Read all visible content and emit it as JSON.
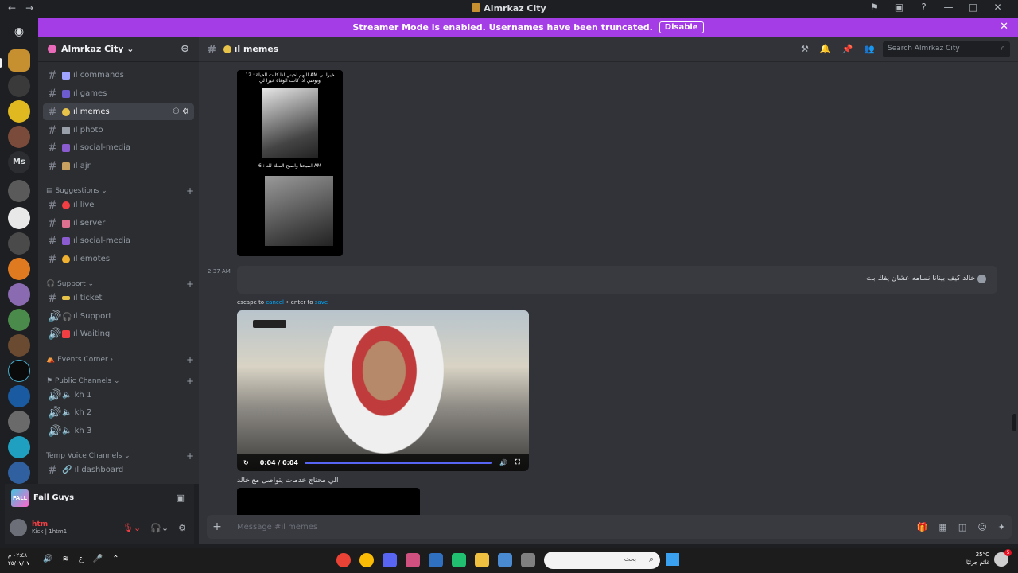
{
  "window": {
    "title": "Almrkaz City",
    "nav_back": "←",
    "nav_fwd": "→",
    "controls": [
      "⚑",
      "▣",
      "?",
      "—",
      "□",
      "✕"
    ]
  },
  "banner": {
    "text": "Streamer Mode is enabled. Usernames have been truncated.",
    "button": "Disable",
    "close": "✕"
  },
  "guilds": {
    "ms_label": "Ms"
  },
  "server": {
    "name": "Almrkaz City ⌄",
    "add_icon": "person-add-icon"
  },
  "channels": [
    {
      "name": "ıl commands",
      "emoji_color": "#a0a4ff"
    },
    {
      "name": "ıl games",
      "emoji_color": "#6d5bd0"
    },
    {
      "name": "ıl memes",
      "emoji_color": "#e8c34a",
      "active": true
    },
    {
      "name": "ıl photo",
      "emoji_color": "#9aa0aa"
    },
    {
      "name": "ıl social-media",
      "emoji_color": "#8a5cd0"
    },
    {
      "name": "ıl ajr",
      "emoji_color": "#c8a060"
    }
  ],
  "categories": {
    "suggestions": "Suggestions",
    "support": "Support",
    "events": "Events Corner",
    "public": "Public Channels",
    "temp": "Temp Voice Channels"
  },
  "suggestion_channels": [
    {
      "name": "ıl live",
      "emoji_color": "#f23f43"
    },
    {
      "name": "ıl server",
      "emoji_color": "#e07090"
    },
    {
      "name": "ıl social-media",
      "emoji_color": "#8a5cd0"
    },
    {
      "name": "ıl emotes",
      "emoji_color": "#f0b030"
    }
  ],
  "support_channels": [
    {
      "name": "ıl ticket",
      "emoji_color": "#e8c34a"
    },
    {
      "name": "ıl Support",
      "emoji_color": "#b5bac1"
    },
    {
      "name": "ıl Waiting",
      "emoji_color": "#f23f43"
    }
  ],
  "voice_channels": [
    "kh 1",
    "kh 2",
    "kh 3"
  ],
  "temp_channels": [
    "ıl dashboard"
  ],
  "game": {
    "logo": "FALL GUYS",
    "name": "Fall Guys"
  },
  "user": {
    "name": "htm",
    "status": "Kick | 1htm1"
  },
  "chat": {
    "channel_name": "ıl memes",
    "search_placeholder": "Search Almrkaz City",
    "meme_top_caption": "اللهم احيني اذا كانت الحياة : 12 AM خيرا لي وتوفني اذا كانت الوفاة خيرا لي",
    "meme_bottom_caption": "اصبحنا واصبح الملك لله : 6 AM",
    "time": "2:37 AM",
    "edit_text": "خالد كيف بينانا نسامه عشان يفك بت",
    "hint_pre": "escape to ",
    "hint_cancel": "cancel",
    "hint_mid": " • enter to ",
    "hint_save": "save",
    "video_time": "0:04 / 0:04",
    "video_progress": 1.0,
    "caption2": "الي محتاج خدمات يتواصل مع خالد",
    "composer_placeholder": "Message #ıl memes"
  },
  "taskbar": {
    "clock_time": "٠٢:٤٨ م",
    "clock_date": "٢٥/٠٧/٠٧",
    "search_placeholder": "بحث",
    "temp": "25°C",
    "weather_desc": "غائم جزئيًا",
    "notif_count": "5"
  }
}
